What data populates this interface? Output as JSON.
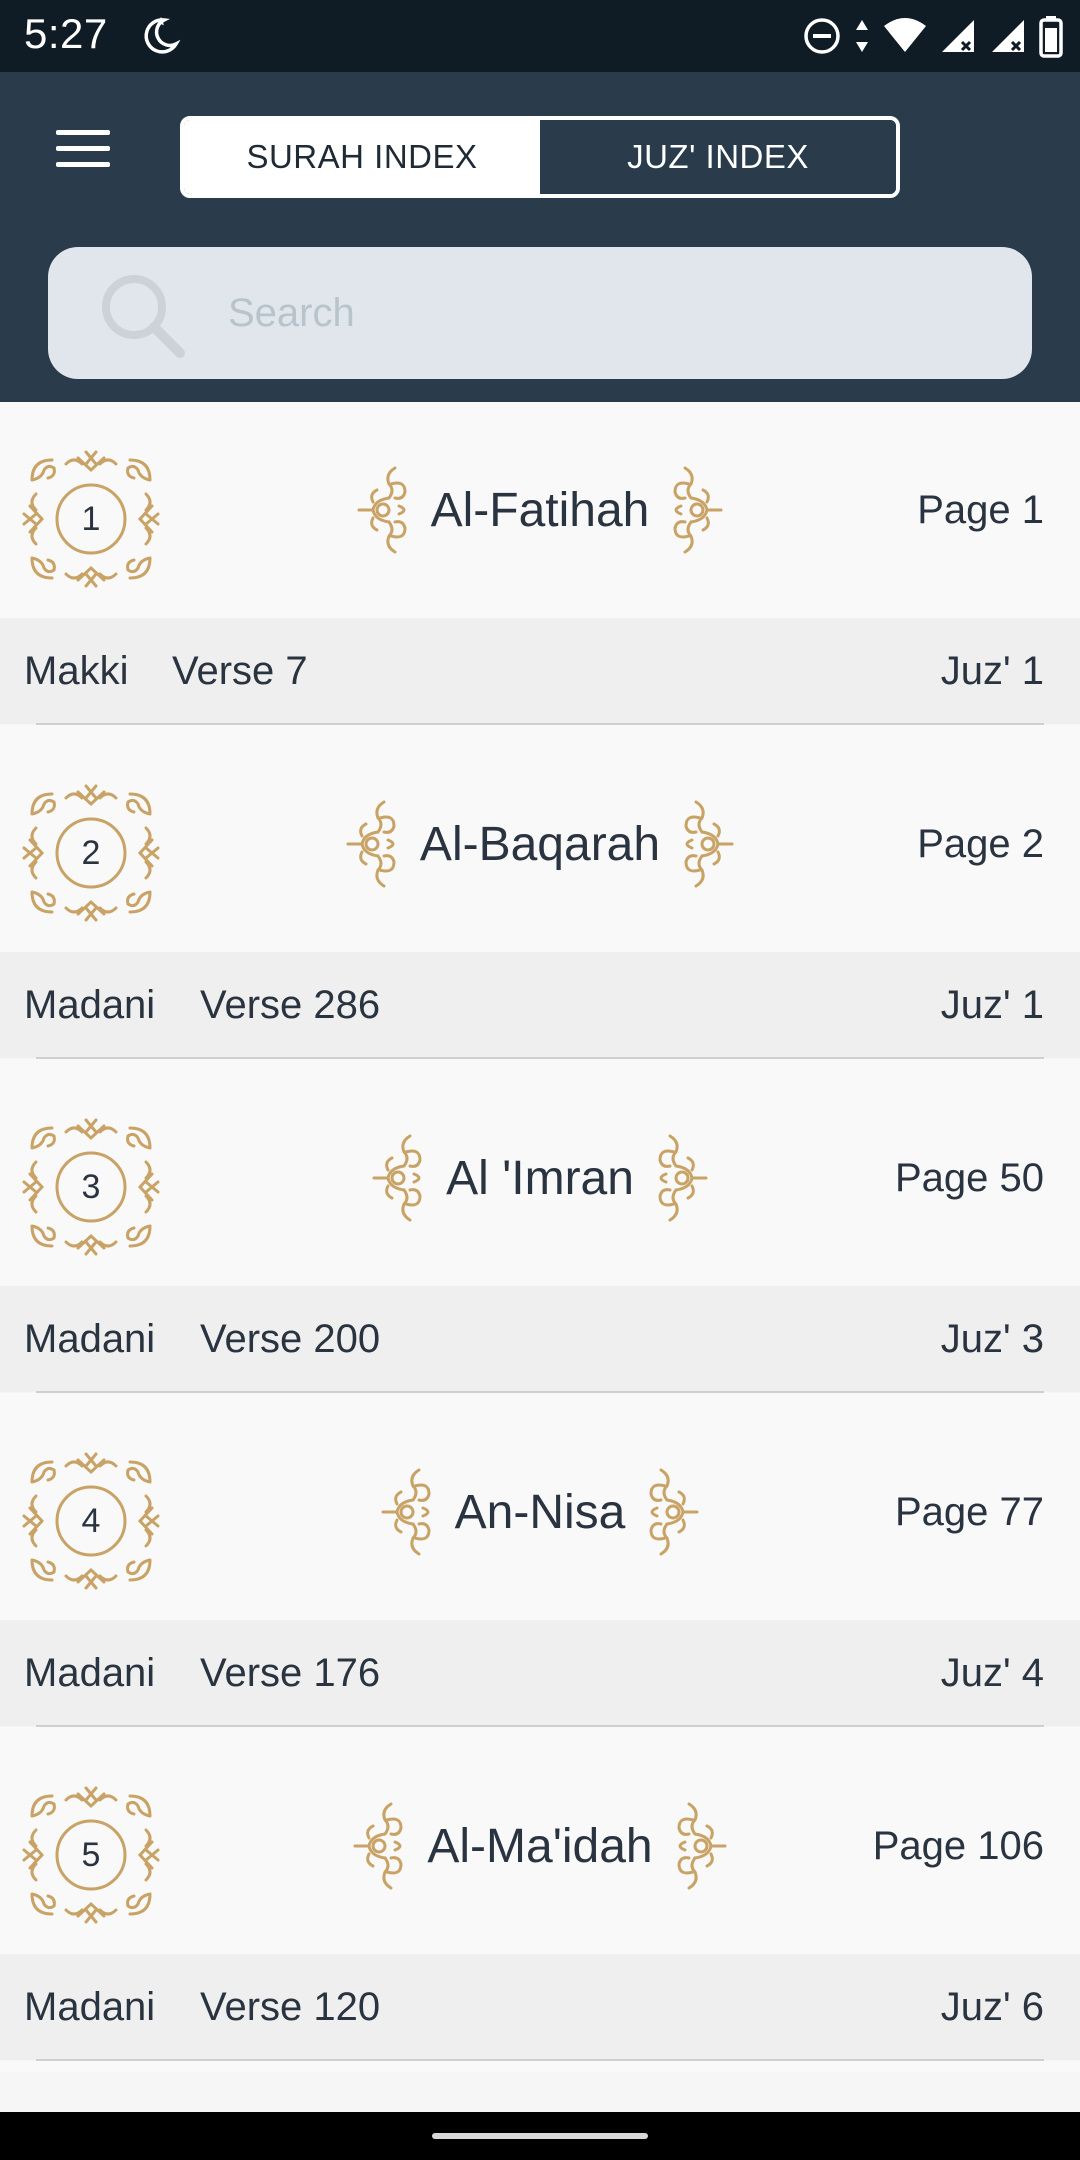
{
  "status_bar": {
    "time": "5:27",
    "left_icons": [
      "moon-icon"
    ],
    "right_icons": [
      "do-not-disturb-icon",
      "data-arrows-icon",
      "wifi-icon",
      "signal-icon",
      "signal-icon",
      "battery-icon"
    ]
  },
  "header": {
    "menu_icon": "hamburger-menu-icon",
    "tabs": [
      {
        "label": "SURAH INDEX",
        "active": true
      },
      {
        "label": "JUZ' INDEX",
        "active": false
      }
    ],
    "search": {
      "placeholder": "Search",
      "value": ""
    }
  },
  "colors": {
    "header_bg": "#2a3b4b",
    "status_bg": "#0f1b25",
    "ornament_gold": "#c9a266"
  },
  "surahs": [
    {
      "number": "1",
      "name": "Al-Fatihah",
      "page": "Page 1",
      "type": "Makki",
      "verse": "Verse 7",
      "juz": "Juz' 1"
    },
    {
      "number": "2",
      "name": "Al-Baqarah",
      "page": "Page 2",
      "type": "Madani",
      "verse": "Verse 286",
      "juz": "Juz' 1"
    },
    {
      "number": "3",
      "name": "Al 'Imran",
      "page": "Page 50",
      "type": "Madani",
      "verse": "Verse 200",
      "juz": "Juz' 3"
    },
    {
      "number": "4",
      "name": "An-Nisa",
      "page": "Page 77",
      "type": "Madani",
      "verse": "Verse 176",
      "juz": "Juz' 4"
    },
    {
      "number": "5",
      "name": "Al-Ma'idah",
      "page": "Page 106",
      "type": "Madani",
      "verse": "Verse 120",
      "juz": "Juz' 6"
    }
  ]
}
